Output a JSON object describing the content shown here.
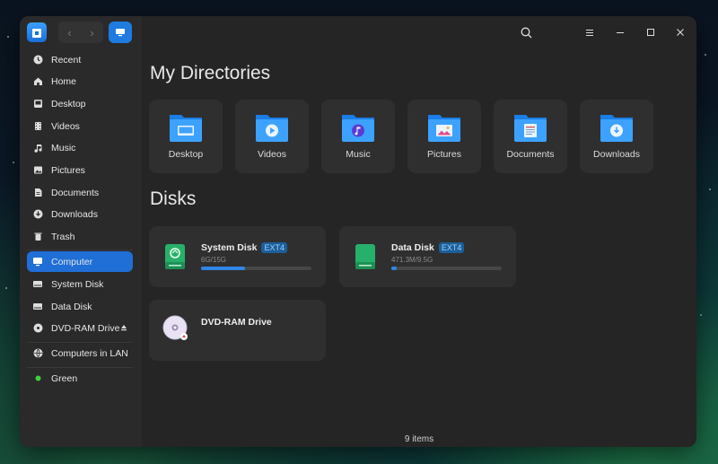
{
  "window": {
    "toolbar": {
      "back_icon": "chevron-left-icon",
      "forward_icon": "chevron-right-icon",
      "view_icon": "computer-view-icon",
      "search_icon": "search-icon",
      "menu_icon": "hamburger-menu-icon",
      "minimize_icon": "minimize-icon",
      "maximize_icon": "maximize-icon",
      "close_icon": "close-icon"
    }
  },
  "sidebar": {
    "items": [
      {
        "label": "Recent",
        "icon": "clock-icon"
      },
      {
        "label": "Home",
        "icon": "home-icon"
      },
      {
        "label": "Desktop",
        "icon": "desktop-icon"
      },
      {
        "label": "Videos",
        "icon": "film-icon"
      },
      {
        "label": "Music",
        "icon": "music-note-icon"
      },
      {
        "label": "Pictures",
        "icon": "image-icon"
      },
      {
        "label": "Documents",
        "icon": "document-icon"
      },
      {
        "label": "Downloads",
        "icon": "download-icon"
      },
      {
        "label": "Trash",
        "icon": "trash-icon"
      },
      {
        "label": "Computer",
        "icon": "monitor-icon",
        "active": true
      },
      {
        "label": "System Disk",
        "icon": "drive-icon"
      },
      {
        "label": "Data Disk",
        "icon": "drive-icon"
      },
      {
        "label": "DVD-RAM Drive",
        "icon": "disc-icon",
        "eject": true
      },
      {
        "label": "Computers in LAN",
        "icon": "network-icon"
      },
      {
        "label": "Green",
        "icon": "tag-dot-icon",
        "dot_color": "#3ecf3e"
      }
    ]
  },
  "main": {
    "directories_title": "My Directories",
    "directories": [
      {
        "label": "Desktop",
        "icon": "folder-desktop-icon"
      },
      {
        "label": "Videos",
        "icon": "folder-videos-icon"
      },
      {
        "label": "Music",
        "icon": "folder-music-icon"
      },
      {
        "label": "Pictures",
        "icon": "folder-pictures-icon"
      },
      {
        "label": "Documents",
        "icon": "folder-documents-icon"
      },
      {
        "label": "Downloads",
        "icon": "folder-downloads-icon"
      }
    ],
    "disks_title": "Disks",
    "disks": [
      {
        "name": "System Disk",
        "fs": "EXT4",
        "usage": "6G/15G",
        "fill": 0.4
      },
      {
        "name": "Data Disk",
        "fs": "EXT4",
        "usage": "471.3M/9.5G",
        "fill": 0.05
      },
      {
        "name": "DVD-RAM Drive"
      }
    ],
    "status": "9 items"
  },
  "colors": {
    "accent": "#1f6fd6",
    "folder": "#2b8ff0",
    "disk_green": "#27b06a"
  }
}
